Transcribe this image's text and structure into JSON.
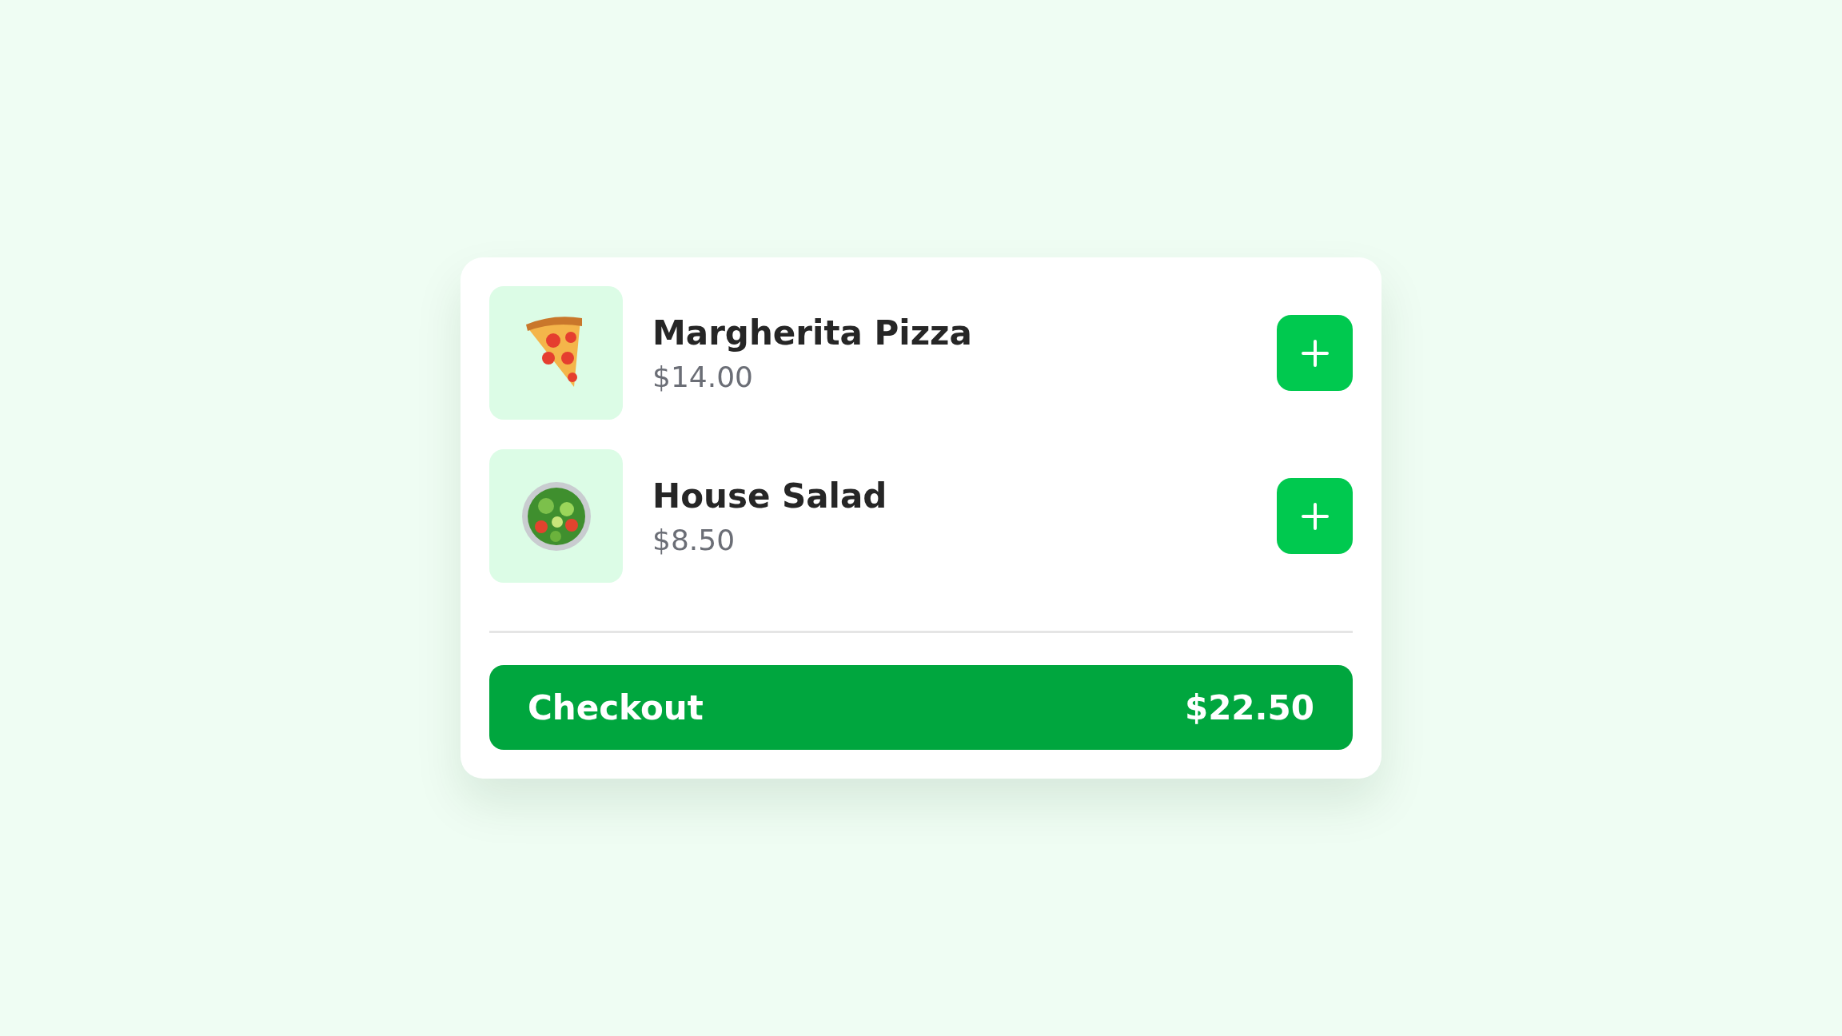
{
  "items": [
    {
      "kind": "pizza",
      "name": "Margherita Pizza",
      "price": "$14.00"
    },
    {
      "kind": "salad",
      "name": "House Salad",
      "price": "$8.50"
    }
  ],
  "checkout": {
    "label": "Checkout",
    "total": "$22.50"
  }
}
